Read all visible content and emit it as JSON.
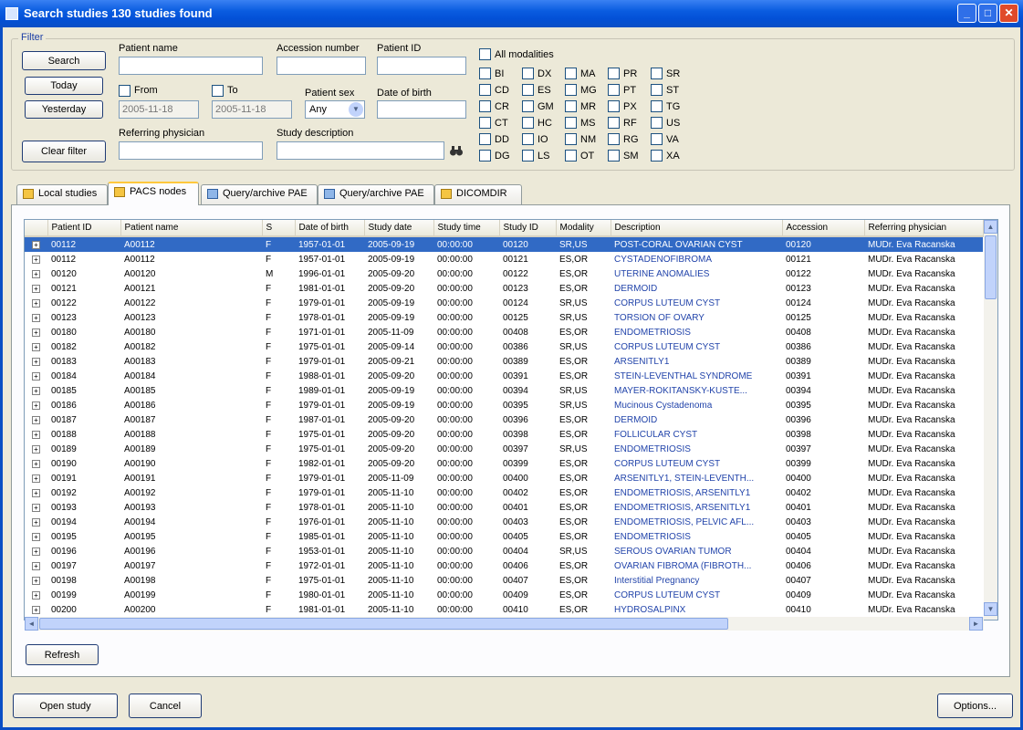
{
  "window": {
    "title": "Search studies   130 studies found",
    "min_label": "_",
    "max_label": "□",
    "close_label": "✕"
  },
  "filter": {
    "group_label": "Filter",
    "buttons": {
      "search": "Search",
      "today": "Today",
      "yesterday": "Yesterday",
      "clear": "Clear filter"
    },
    "patient_name_label": "Patient name",
    "accession_label": "Accession number",
    "patient_id_label": "Patient ID",
    "from_label": "From",
    "to_label": "To",
    "from_value": "2005-11-18",
    "to_value": "2005-11-18",
    "patient_sex_label": "Patient sex",
    "patient_sex_value": "Any",
    "dob_label": "Date of birth",
    "referring_label": "Referring physician",
    "study_desc_label": "Study description",
    "all_modalities_label": "All modalities",
    "modalities": [
      "BI",
      "CD",
      "CR",
      "CT",
      "DD",
      "DG",
      "DX",
      "ES",
      "GM",
      "HC",
      "IO",
      "LS",
      "MA",
      "MG",
      "MR",
      "MS",
      "NM",
      "OT",
      "PR",
      "PT",
      "PX",
      "RF",
      "RG",
      "SM",
      "SR",
      "ST",
      "TG",
      "US",
      "VA",
      "XA"
    ]
  },
  "tabs": [
    "Local studies",
    "PACS nodes",
    "Query/archive PAE",
    "Query/archive PAE",
    "DICOMDIR"
  ],
  "table": {
    "columns": [
      "",
      "Patient ID",
      "Patient name",
      "S",
      "Date of birth",
      "Study date",
      "Study time",
      "Study ID",
      "Modality",
      "Description",
      "Accession",
      "Referring physician"
    ],
    "rows": [
      [
        "00112",
        "A00112",
        "F",
        "1957-01-01",
        "2005-09-19",
        "00:00:00",
        "00120",
        "SR,US",
        "POST-CORAL OVARIAN CYST",
        "00120",
        "MUDr. Eva Racanska"
      ],
      [
        "00112",
        "A00112",
        "F",
        "1957-01-01",
        "2005-09-19",
        "00:00:00",
        "00121",
        "ES,OR",
        "CYSTADENOFIBROMA",
        "00121",
        "MUDr. Eva Racanska"
      ],
      [
        "00120",
        "A00120",
        "M",
        "1996-01-01",
        "2005-09-20",
        "00:00:00",
        "00122",
        "ES,OR",
        "UTERINE ANOMALIES",
        "00122",
        "MUDr. Eva Racanska"
      ],
      [
        "00121",
        "A00121",
        "F",
        "1981-01-01",
        "2005-09-20",
        "00:00:00",
        "00123",
        "ES,OR",
        "DERMOID",
        "00123",
        "MUDr. Eva Racanska"
      ],
      [
        "00122",
        "A00122",
        "F",
        "1979-01-01",
        "2005-09-19",
        "00:00:00",
        "00124",
        "SR,US",
        "CORPUS LUTEUM CYST",
        "00124",
        "MUDr. Eva Racanska"
      ],
      [
        "00123",
        "A00123",
        "F",
        "1978-01-01",
        "2005-09-19",
        "00:00:00",
        "00125",
        "SR,US",
        "TORSION OF OVARY",
        "00125",
        "MUDr. Eva Racanska"
      ],
      [
        "00180",
        "A00180",
        "F",
        "1971-01-01",
        "2005-11-09",
        "00:00:00",
        "00408",
        "ES,OR",
        "ENDOMETRIOSIS",
        "00408",
        "MUDr. Eva Racanska"
      ],
      [
        "00182",
        "A00182",
        "F",
        "1975-01-01",
        "2005-09-14",
        "00:00:00",
        "00386",
        "SR,US",
        "CORPUS LUTEUM CYST",
        "00386",
        "MUDr. Eva Racanska"
      ],
      [
        "00183",
        "A00183",
        "F",
        "1979-01-01",
        "2005-09-21",
        "00:00:00",
        "00389",
        "ES,OR",
        "ARSENITLY1",
        "00389",
        "MUDr. Eva Racanska"
      ],
      [
        "00184",
        "A00184",
        "F",
        "1988-01-01",
        "2005-09-20",
        "00:00:00",
        "00391",
        "ES,OR",
        "STEIN-LEVENTHAL SYNDROME",
        "00391",
        "MUDr. Eva Racanska"
      ],
      [
        "00185",
        "A00185",
        "F",
        "1989-01-01",
        "2005-09-19",
        "00:00:00",
        "00394",
        "SR,US",
        "MAYER-ROKITANSKY-KUSTE...",
        "00394",
        "MUDr. Eva Racanska"
      ],
      [
        "00186",
        "A00186",
        "F",
        "1979-01-01",
        "2005-09-19",
        "00:00:00",
        "00395",
        "SR,US",
        "Mucinous Cystadenoma",
        "00395",
        "MUDr. Eva Racanska"
      ],
      [
        "00187",
        "A00187",
        "F",
        "1987-01-01",
        "2005-09-20",
        "00:00:00",
        "00396",
        "ES,OR",
        "DERMOID",
        "00396",
        "MUDr. Eva Racanska"
      ],
      [
        "00188",
        "A00188",
        "F",
        "1975-01-01",
        "2005-09-20",
        "00:00:00",
        "00398",
        "ES,OR",
        "FOLLICULAR CYST",
        "00398",
        "MUDr. Eva Racanska"
      ],
      [
        "00189",
        "A00189",
        "F",
        "1975-01-01",
        "2005-09-20",
        "00:00:00",
        "00397",
        "SR,US",
        "ENDOMETRIOSIS",
        "00397",
        "MUDr. Eva Racanska"
      ],
      [
        "00190",
        "A00190",
        "F",
        "1982-01-01",
        "2005-09-20",
        "00:00:00",
        "00399",
        "ES,OR",
        "CORPUS LUTEUM CYST",
        "00399",
        "MUDr. Eva Racanska"
      ],
      [
        "00191",
        "A00191",
        "F",
        "1979-01-01",
        "2005-11-09",
        "00:00:00",
        "00400",
        "ES,OR",
        "ARSENITLY1, STEIN-LEVENTH...",
        "00400",
        "MUDr. Eva Racanska"
      ],
      [
        "00192",
        "A00192",
        "F",
        "1979-01-01",
        "2005-11-10",
        "00:00:00",
        "00402",
        "ES,OR",
        "ENDOMETRIOSIS, ARSENITLY1",
        "00402",
        "MUDr. Eva Racanska"
      ],
      [
        "00193",
        "A00193",
        "F",
        "1978-01-01",
        "2005-11-10",
        "00:00:00",
        "00401",
        "ES,OR",
        "ENDOMETRIOSIS, ARSENITLY1",
        "00401",
        "MUDr. Eva Racanska"
      ],
      [
        "00194",
        "A00194",
        "F",
        "1976-01-01",
        "2005-11-10",
        "00:00:00",
        "00403",
        "ES,OR",
        "ENDOMETRIOSIS, PELVIC AFL...",
        "00403",
        "MUDr. Eva Racanska"
      ],
      [
        "00195",
        "A00195",
        "F",
        "1985-01-01",
        "2005-11-10",
        "00:00:00",
        "00405",
        "ES,OR",
        "ENDOMETRIOSIS",
        "00405",
        "MUDr. Eva Racanska"
      ],
      [
        "00196",
        "A00196",
        "F",
        "1953-01-01",
        "2005-11-10",
        "00:00:00",
        "00404",
        "SR,US",
        "SEROUS OVARIAN TUMOR",
        "00404",
        "MUDr. Eva Racanska"
      ],
      [
        "00197",
        "A00197",
        "F",
        "1972-01-01",
        "2005-11-10",
        "00:00:00",
        "00406",
        "ES,OR",
        "OVARIAN FIBROMA (FIBROTH...",
        "00406",
        "MUDr. Eva Racanska"
      ],
      [
        "00198",
        "A00198",
        "F",
        "1975-01-01",
        "2005-11-10",
        "00:00:00",
        "00407",
        "ES,OR",
        "Interstitial Pregnancy",
        "00407",
        "MUDr. Eva Racanska"
      ],
      [
        "00199",
        "A00199",
        "F",
        "1980-01-01",
        "2005-11-10",
        "00:00:00",
        "00409",
        "ES,OR",
        "CORPUS LUTEUM CYST",
        "00409",
        "MUDr. Eva Racanska"
      ],
      [
        "00200",
        "A00200",
        "F",
        "1981-01-01",
        "2005-11-10",
        "00:00:00",
        "00410",
        "ES,OR",
        "HYDROSALPINX",
        "00410",
        "MUDr. Eva Racanska"
      ]
    ]
  },
  "buttons": {
    "refresh": "Refresh",
    "open_study": "Open study",
    "cancel": "Cancel",
    "options": "Options..."
  }
}
